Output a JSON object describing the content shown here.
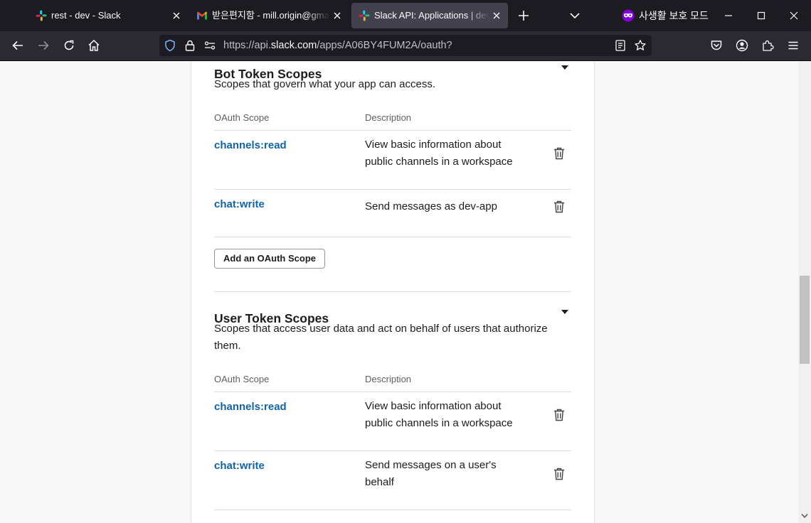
{
  "tabs": [
    {
      "title": "rest - dev - Slack",
      "favicon": "slack-icon",
      "active": false
    },
    {
      "title": "받은편지함 - mill.origin@gmail.com",
      "favicon": "gmail-icon",
      "active": false
    },
    {
      "title": "Slack API: Applications | dev Slack",
      "favicon": "slack-icon",
      "active": true
    }
  ],
  "private_mode_label": "사생활 보호 모드",
  "url": {
    "prefix": "https://api.",
    "domain": "slack.com",
    "path": "/apps/A06BY4FUM2A/oauth?"
  },
  "bot_section": {
    "title": "Bot Token Scopes",
    "description": "Scopes that govern what your app can access.",
    "col_scope": "OAuth Scope",
    "col_description": "Description",
    "scopes": [
      {
        "name": "channels:read",
        "description": "View basic information about public channels in a workspace"
      },
      {
        "name": "chat:write",
        "description": "Send messages as dev-app"
      }
    ],
    "add_button": "Add an OAuth Scope"
  },
  "user_section": {
    "title": "User Token Scopes",
    "description": "Scopes that access user data and act on behalf of users that authorize them.",
    "col_scope": "OAuth Scope",
    "col_description": "Description",
    "scopes": [
      {
        "name": "channels:read",
        "description": "View basic information about public channels in a workspace"
      },
      {
        "name": "chat:write",
        "description": "Send messages on a user's behalf"
      }
    ]
  },
  "colors": {
    "link": "#1264a3",
    "text": "#1d1c1d",
    "browser_bg": "#1c1b22",
    "private_accent": "#8000d7"
  }
}
